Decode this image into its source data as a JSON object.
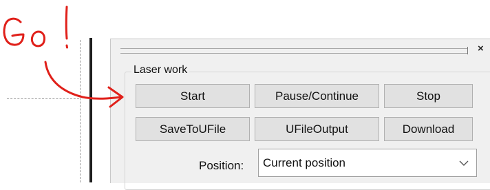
{
  "annotation": {
    "text": "Go!",
    "color": "#e0201a"
  },
  "panel": {
    "close_label": "×",
    "group_title": "Laser work",
    "buttons_row1": {
      "start": "Start",
      "pause": "Pause/Continue",
      "stop": "Stop"
    },
    "buttons_row2": {
      "save": "SaveToUFile",
      "ufile": "UFileOutput",
      "download": "Download"
    },
    "position_label": "Position:",
    "position_value": "Current position"
  }
}
